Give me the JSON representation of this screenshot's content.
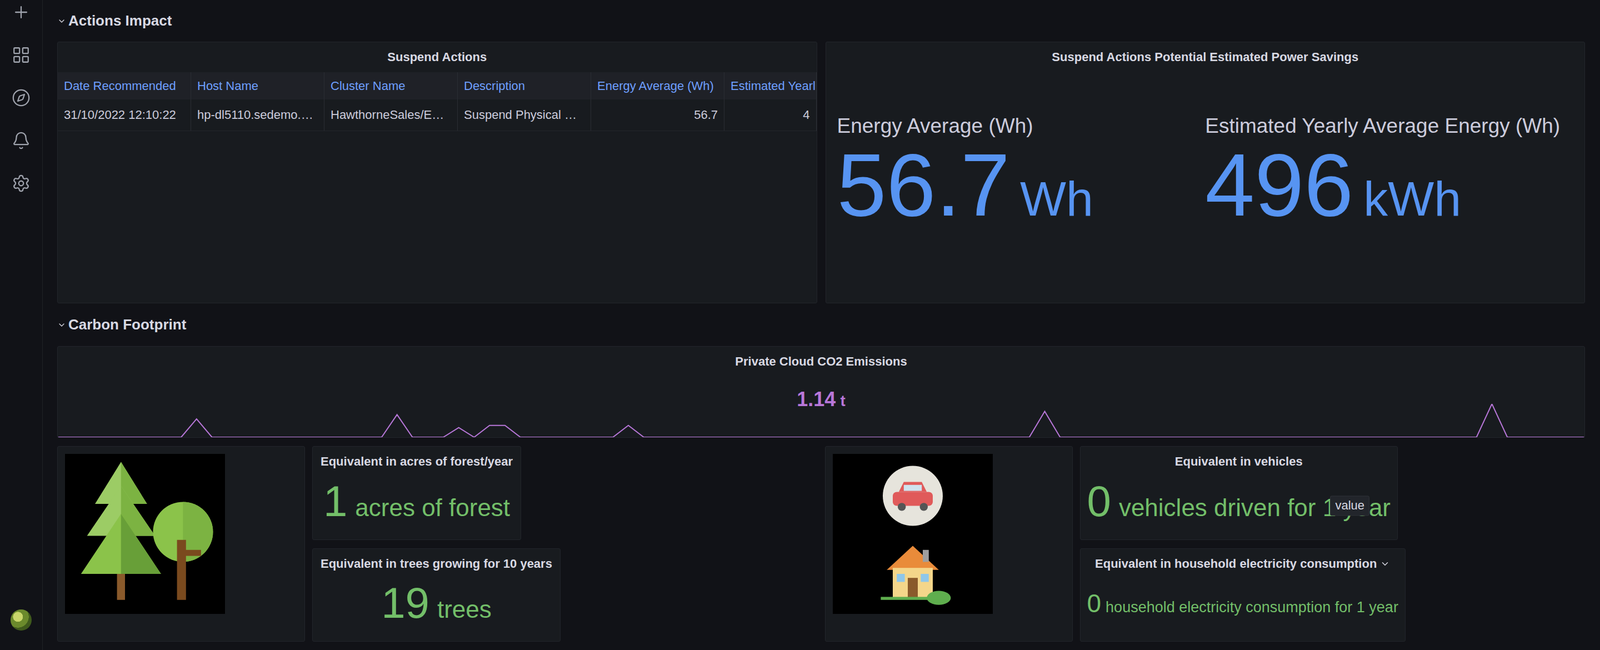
{
  "sections": [
    {
      "title": "Actions Impact",
      "expanded": true
    },
    {
      "title": "Carbon Footprint",
      "expanded": true
    }
  ],
  "suspend_actions": {
    "title": "Suspend Actions",
    "columns": [
      {
        "label": "Date Recommended",
        "kind": "text"
      },
      {
        "label": "Host Name",
        "kind": "text"
      },
      {
        "label": "Cluster Name",
        "kind": "text"
      },
      {
        "label": "Description",
        "kind": "text"
      },
      {
        "label": "Energy Average (Wh)",
        "kind": "number"
      },
      {
        "label": "Estimated Yearl",
        "kind": "number"
      }
    ],
    "rows": [
      [
        "31/10/2022 12:10:22",
        "hp-dl5110.sedemo.…",
        "HawthorneSales/E…",
        "Suspend Physical …",
        "56.7",
        "4"
      ]
    ]
  },
  "power_savings": {
    "title": "Suspend Actions Potential Estimated Power Savings",
    "stats": [
      {
        "label": "Energy Average (Wh)",
        "value": "56.7",
        "unit": "Wh"
      },
      {
        "label": "Estimated Yearly Average Energy (Wh)",
        "value": "496",
        "unit": "kWh"
      }
    ]
  },
  "co2": {
    "title": "Private Cloud CO2 Emissions",
    "value": "1.14",
    "unit": "t",
    "series": [
      0,
      0,
      0,
      0,
      0,
      0,
      0,
      0,
      0,
      17,
      0,
      0,
      0,
      0,
      0,
      0,
      0,
      0,
      0,
      0,
      0,
      0,
      21,
      0,
      0,
      0,
      9,
      0,
      11,
      11,
      0,
      0,
      0,
      0,
      0,
      0,
      0,
      11,
      0,
      0,
      0,
      0,
      0,
      0,
      0,
      0,
      0,
      0,
      0,
      0,
      0,
      0,
      0,
      0,
      0,
      0,
      0,
      0,
      0,
      0,
      0,
      0,
      0,
      0,
      24,
      0,
      0,
      0,
      0,
      0,
      0,
      0,
      0,
      0,
      0,
      0,
      0,
      0,
      0,
      0,
      0,
      0,
      0,
      0,
      0,
      0,
      0,
      0,
      0,
      0,
      0,
      0,
      0,
      31,
      0,
      0,
      0,
      0,
      0,
      0
    ]
  },
  "equivalents": [
    {
      "title": "Equivalent in acres of forest/year",
      "value": "1",
      "unit": "acres of forest",
      "kind": "large",
      "menu": false
    },
    {
      "title": "Equivalent in trees growing for 10 years",
      "value": "19",
      "unit": "trees",
      "kind": "large",
      "menu": false
    },
    {
      "title": "Equivalent in vehicles",
      "value": "0",
      "unit": "vehicles driven for 1 year",
      "kind": "large",
      "menu": false,
      "tooltip": "value"
    },
    {
      "title": "Equivalent in household electricity consumption",
      "value": "0",
      "unit": "household electricity consumption for 1 year",
      "kind": "compact",
      "menu": true
    }
  ]
}
